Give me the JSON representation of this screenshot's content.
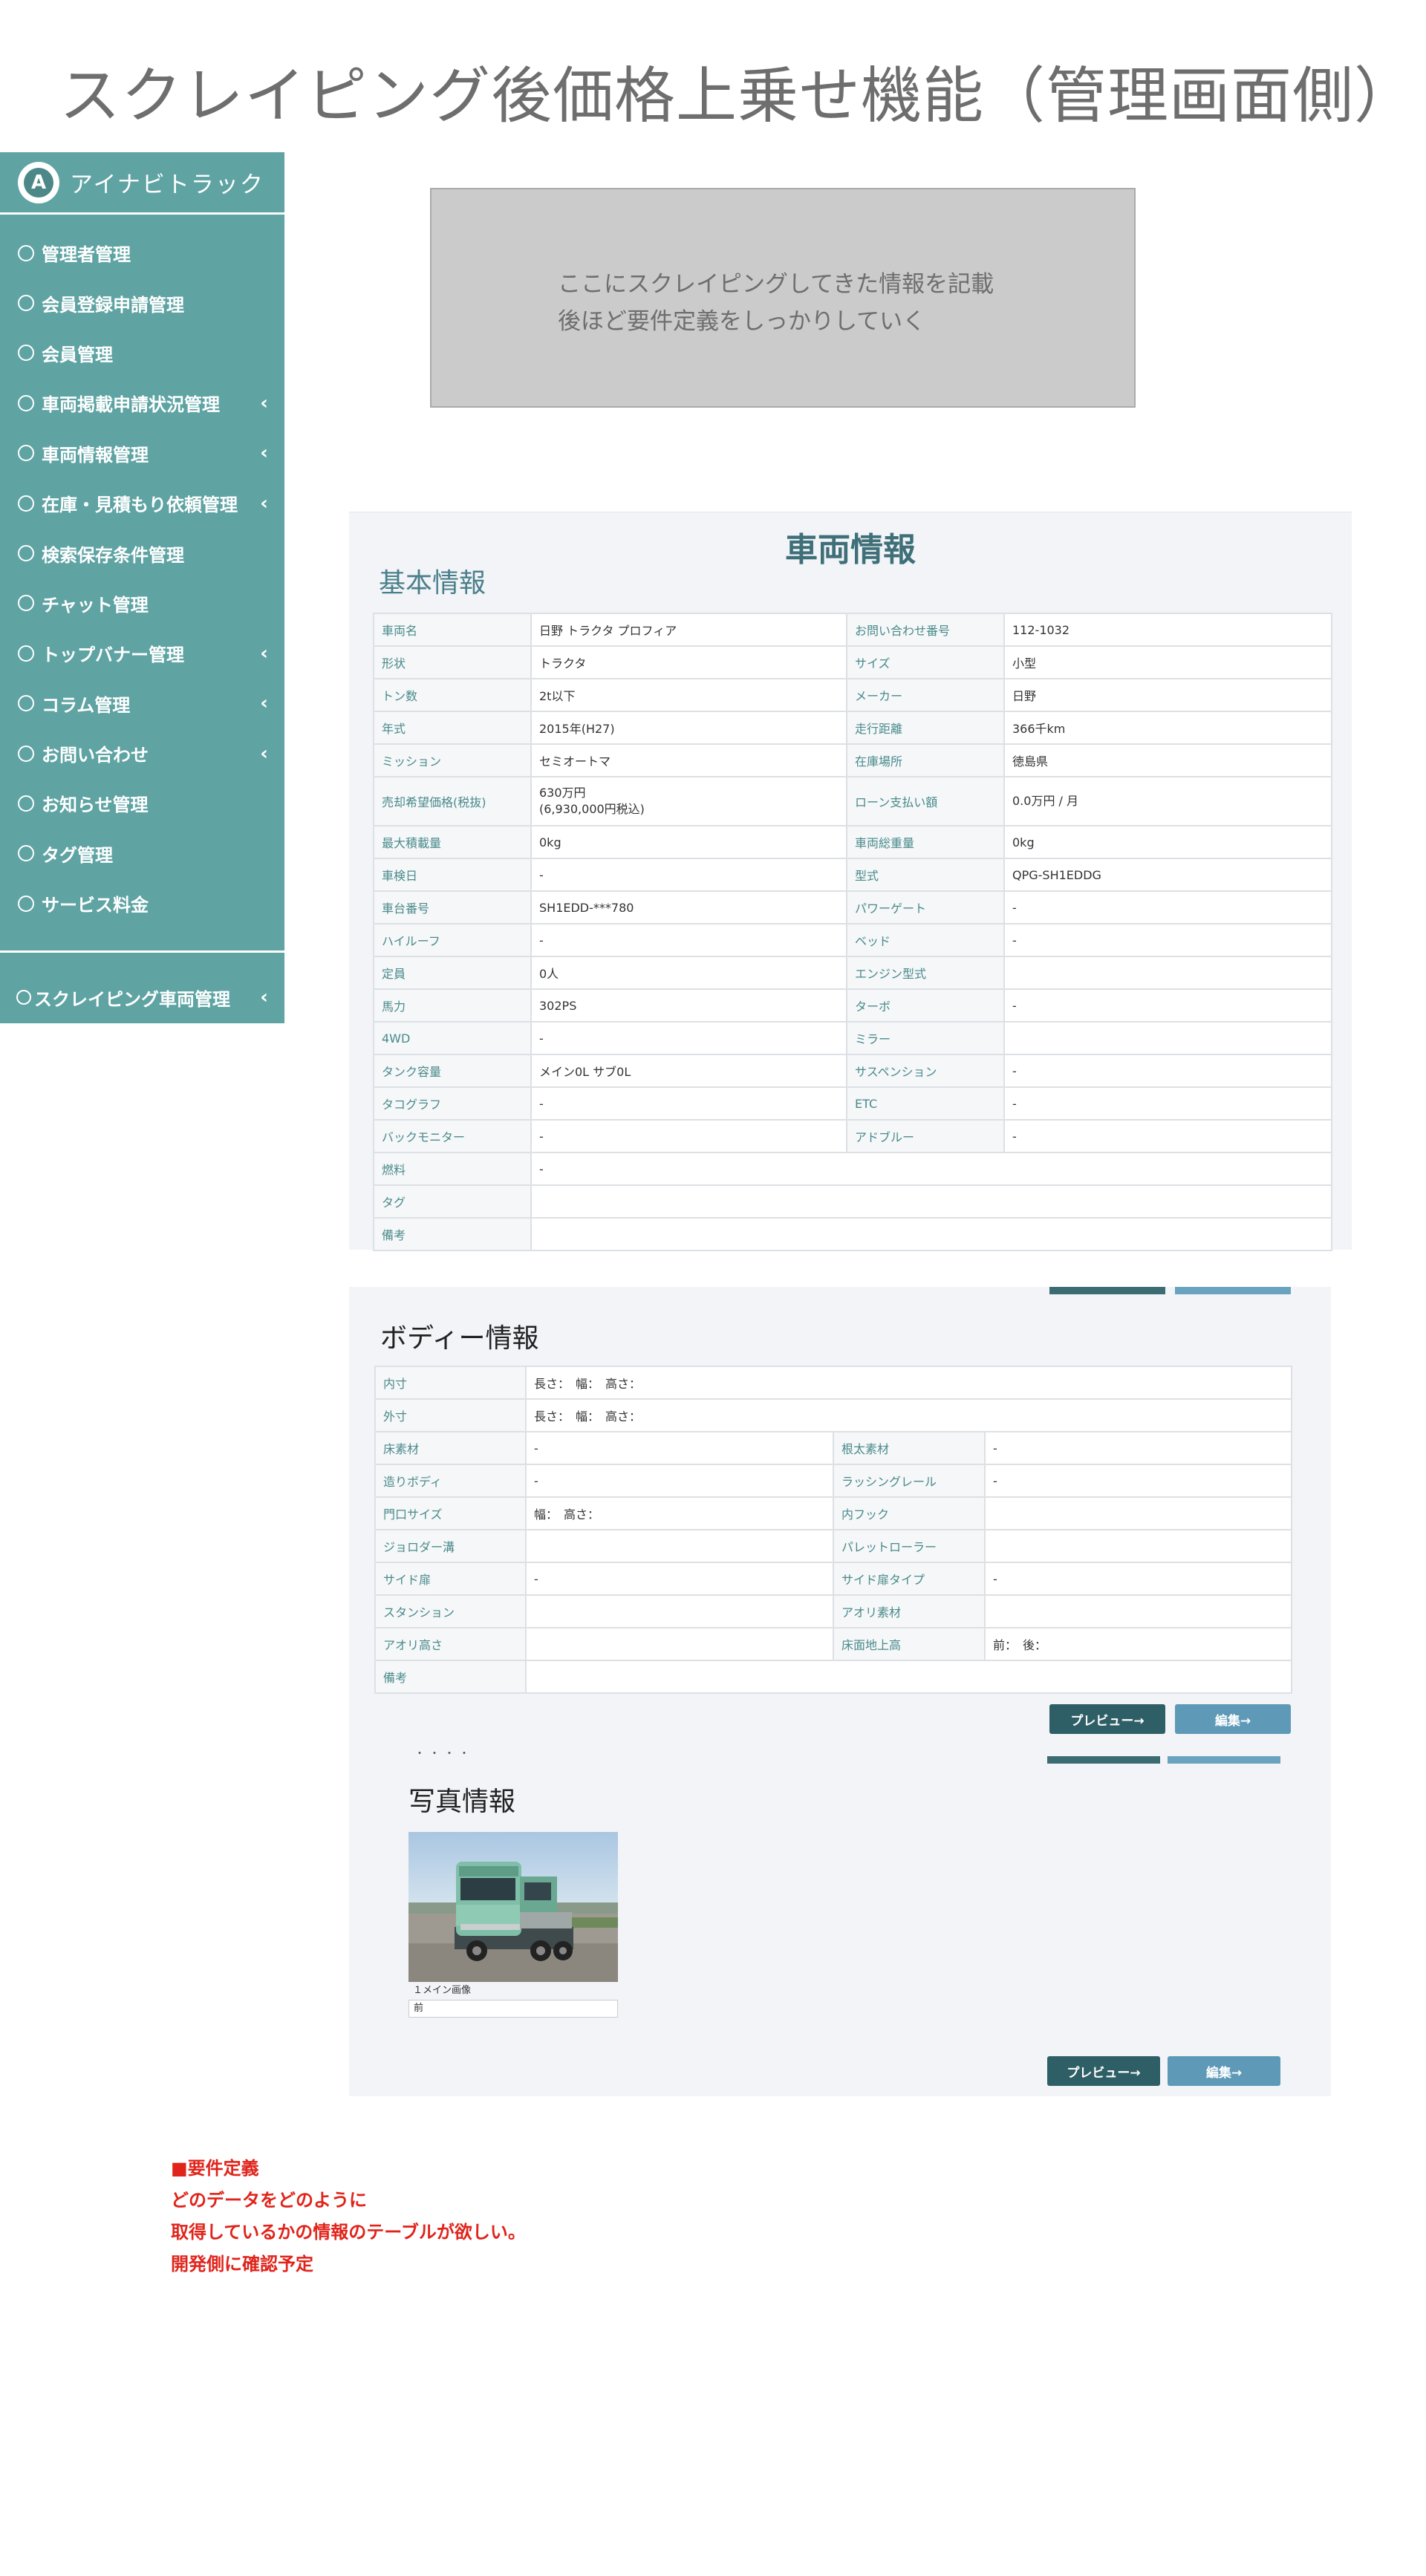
{
  "page": {
    "title": "スクレイピング後価格上乗せ機能（管理画面側）"
  },
  "sidebar": {
    "brand": "アイナビトラック",
    "logo_letter": "A",
    "items": [
      {
        "label": "管理者管理",
        "chevron": ""
      },
      {
        "label": "会員登録申請管理",
        "chevron": ""
      },
      {
        "label": "会員管理",
        "chevron": ""
      },
      {
        "label": "車両掲載申請状況管理",
        "chevron": "‹"
      },
      {
        "label": "車両情報管理",
        "chevron": "‹"
      },
      {
        "label": "在庫・見積もり依頼管理",
        "chevron": "‹"
      },
      {
        "label": "検索保存条件管理",
        "chevron": ""
      },
      {
        "label": "チャット管理",
        "chevron": ""
      },
      {
        "label": "トップバナー管理",
        "chevron": "‹"
      },
      {
        "label": "コラム管理",
        "chevron": "‹"
      },
      {
        "label": "お問い合わせ",
        "chevron": "‹"
      },
      {
        "label": "お知らせ管理",
        "chevron": ""
      },
      {
        "label": "タグ管理",
        "chevron": ""
      },
      {
        "label": "サービス料金",
        "chevron": ""
      }
    ],
    "special_item": {
      "label": "スクレイピング車両管理",
      "chevron": "‹"
    }
  },
  "placeholder": {
    "line1": "ここにスクレイピングしてきた情報を記載",
    "line2": "後ほど要件定義をしっかりしていく"
  },
  "vehicle": {
    "title": "車両情報",
    "basic_title": "基本情報",
    "rows": [
      [
        "車両名",
        "日野 トラクタ プロフィア",
        "お問い合わせ番号",
        "112-1032"
      ],
      [
        "形状",
        "トラクタ",
        "サイズ",
        "小型"
      ],
      [
        "トン数",
        "2t以下",
        "メーカー",
        "日野"
      ],
      [
        "年式",
        "2015年(H27)",
        "走行距離",
        "366千km"
      ],
      [
        "ミッション",
        "セミオートマ",
        "在庫場所",
        "徳島県"
      ],
      [
        "売却希望価格(税抜)",
        "630万円\n(6,930,000円税込)",
        "ローン支払い額",
        "0.0万円 / 月"
      ],
      [
        "最大積載量",
        "0kg",
        "車両総重量",
        "0kg"
      ],
      [
        "車検日",
        "-",
        "型式",
        "QPG-SH1EDDG"
      ],
      [
        "車台番号",
        "SH1EDD-***780",
        "パワーゲート",
        "-"
      ],
      [
        "ハイルーフ",
        "-",
        "ベッド",
        "-"
      ],
      [
        "定員",
        "0人",
        "エンジン型式",
        ""
      ],
      [
        "馬力",
        "302PS",
        "ターボ",
        "-"
      ],
      [
        "4WD",
        "-",
        "ミラー",
        ""
      ],
      [
        "タンク容量",
        "メイン0L サブ0L",
        "サスペンション",
        "-"
      ],
      [
        "タコグラフ",
        "-",
        "ETC",
        "-"
      ],
      [
        "バックモニター",
        "-",
        "アドブルー",
        "-"
      ]
    ],
    "wide_rows": [
      [
        "燃料",
        "-"
      ],
      [
        "タグ",
        ""
      ],
      [
        "備考",
        ""
      ]
    ]
  },
  "body_info": {
    "title": "ボディー情報",
    "wide_top": [
      [
        "内寸",
        "長さ：　幅：　高さ："
      ],
      [
        "外寸",
        "長さ：　幅：　高さ："
      ]
    ],
    "rows": [
      [
        "床素材",
        "-",
        "根太素材",
        "-"
      ],
      [
        "造りボディ",
        "-",
        "ラッシングレール",
        "-"
      ],
      [
        "門口サイズ",
        "幅：　高さ：",
        "内フック",
        ""
      ],
      [
        "ジョロダー溝",
        "",
        "パレットローラー",
        ""
      ],
      [
        "サイド扉",
        "-",
        "サイド扉タイプ",
        "-"
      ],
      [
        "スタンション",
        "",
        "アオリ素材",
        ""
      ],
      [
        "アオリ高さ",
        "",
        "床面地上高",
        "前：　後："
      ]
    ],
    "wide_bottom": [
      [
        "備考",
        ""
      ]
    ],
    "preview_label": "プレビュー→",
    "edit_label": "編集→",
    "dots": "・・・・"
  },
  "photo_info": {
    "title": "写真情報",
    "caption": "１メイン画像",
    "sub": "前",
    "preview_label": "プレビュー→",
    "edit_label": "編集→"
  },
  "requirements": {
    "lines": [
      "■要件定義",
      "どのデータをどのように",
      "取得しているかの情報のテーブルが欲しい。",
      "開発側に確認予定"
    ]
  },
  "colors": {
    "sidebar_bg": "#5fa3a3",
    "accent_dark": "#2f5f66",
    "accent_light": "#5e9ab8",
    "requirement_red": "#e0241b"
  }
}
